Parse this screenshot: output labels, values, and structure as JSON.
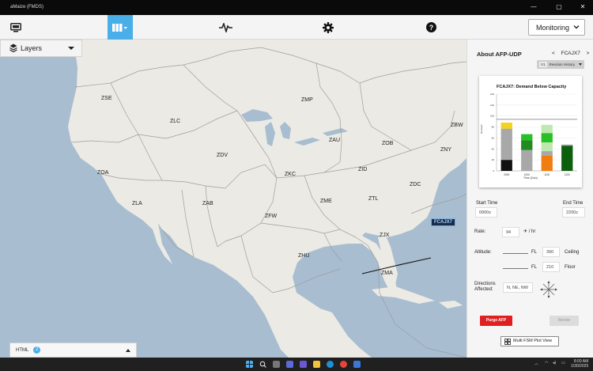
{
  "window": {
    "title": "aMaize (FMDS)",
    "controls": {
      "minimize": "—",
      "maximize": "▢",
      "close": "✕"
    }
  },
  "nav": {
    "icons": [
      "display-icon",
      "map-columns-icon",
      "pulse-icon",
      "gear-icon",
      "help-icon"
    ],
    "active_index": 1,
    "view_select": "Monitoring"
  },
  "map": {
    "layers_label": "Layers",
    "centers": [
      {
        "id": "ZSE"
      },
      {
        "id": "ZLC"
      },
      {
        "id": "ZMP"
      },
      {
        "id": "ZBW"
      },
      {
        "id": "ZOA"
      },
      {
        "id": "ZDV"
      },
      {
        "id": "ZAU"
      },
      {
        "id": "ZOB"
      },
      {
        "id": "ZNY"
      },
      {
        "id": "ZKC"
      },
      {
        "id": "ZID"
      },
      {
        "id": "ZDC"
      },
      {
        "id": "ZLA"
      },
      {
        "id": "ZAB"
      },
      {
        "id": "ZME"
      },
      {
        "id": "ZTL"
      },
      {
        "id": "ZFW"
      },
      {
        "id": "ZJX"
      },
      {
        "id": "ZHU"
      },
      {
        "id": "ZMA"
      }
    ],
    "afp_label": "FCAJX7",
    "bottom_bar": {
      "label": "HTML",
      "count": "2"
    }
  },
  "panel": {
    "title": "About AFP-UDP",
    "prev": "<",
    "afp_name": "FCAJX7",
    "next": ">",
    "revision": {
      "version": "V1",
      "label": "Revision History"
    },
    "start_time_label": "Start Time",
    "start_time": "0900z",
    "end_time_label": "End Time",
    "end_time": "2200z",
    "rate_label": "Rate:",
    "rate": "94",
    "rate_unit": "/ hr",
    "altitude_label": "Altitude:",
    "fl_label": "FL",
    "ceiling_value": "390",
    "ceiling_label": "Ceiling",
    "floor_value": "210",
    "floor_label": "Floor",
    "directions_label": "Directions Affected:",
    "directions": "N, NE, NW",
    "purge_label": "Purge AFP",
    "revise_label": "Revise",
    "multi_label": "Multi FSM Plot View"
  },
  "chart_data": {
    "type": "bar",
    "title": "FCAJX7: Demand Below Capacity",
    "xlabel": "Time (Zulu)",
    "ylabel": "Demand",
    "categories": [
      "0900",
      "1000",
      "1100",
      "1200"
    ],
    "ylim": [
      0,
      140
    ],
    "yticks": [
      0,
      20,
      40,
      60,
      80,
      100,
      120,
      140
    ],
    "capacity_line": 94,
    "stacks": [
      [
        {
          "value": 20,
          "color": "#111111"
        },
        {
          "value": 57,
          "color": "#a8a8a8"
        },
        {
          "value": 11,
          "color": "#f4d21d"
        }
      ],
      [
        {
          "value": 38,
          "color": "#a8a8a8"
        },
        {
          "value": 18,
          "color": "#1e8c1e"
        },
        {
          "value": 11,
          "color": "#27c127"
        }
      ],
      [
        {
          "value": 28,
          "color": "#f07d10"
        },
        {
          "value": 8,
          "color": "#a8a8a8"
        },
        {
          "value": 16,
          "color": "#bfe8b0"
        },
        {
          "value": 17,
          "color": "#27c127"
        },
        {
          "value": 15,
          "color": "#bfe8b0"
        }
      ],
      [
        {
          "value": 46,
          "color": "#0c5f0c"
        },
        {
          "value": 2,
          "color": "#a8a8a8"
        }
      ]
    ]
  },
  "taskbar": {
    "time": "8:00 AM",
    "date": "1/30/2025"
  }
}
